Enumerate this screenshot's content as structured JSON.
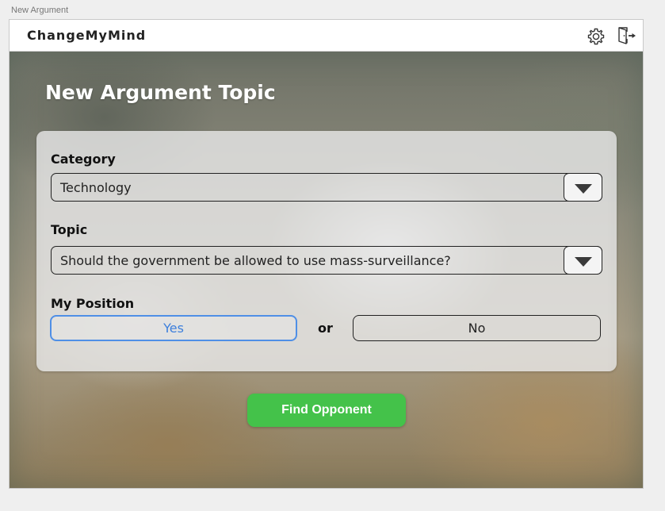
{
  "window": {
    "caption": "New Argument"
  },
  "header": {
    "brand": "ChangeMyMind",
    "icons": [
      "gear-icon",
      "exit-door-icon"
    ]
  },
  "page": {
    "title": "New Argument Topic"
  },
  "form": {
    "category": {
      "label": "Category",
      "value": "Technology"
    },
    "topic": {
      "label": "Topic",
      "value": "Should the government be allowed to use mass-surveillance?"
    },
    "position": {
      "label": "My Position",
      "yes_label": "Yes",
      "or_label": "or",
      "no_label": "No",
      "selected": "Yes"
    }
  },
  "actions": {
    "find_opponent_label": "Find Opponent"
  },
  "colors": {
    "accent_blue": "#4f8fe6",
    "action_green": "#44c24a"
  }
}
